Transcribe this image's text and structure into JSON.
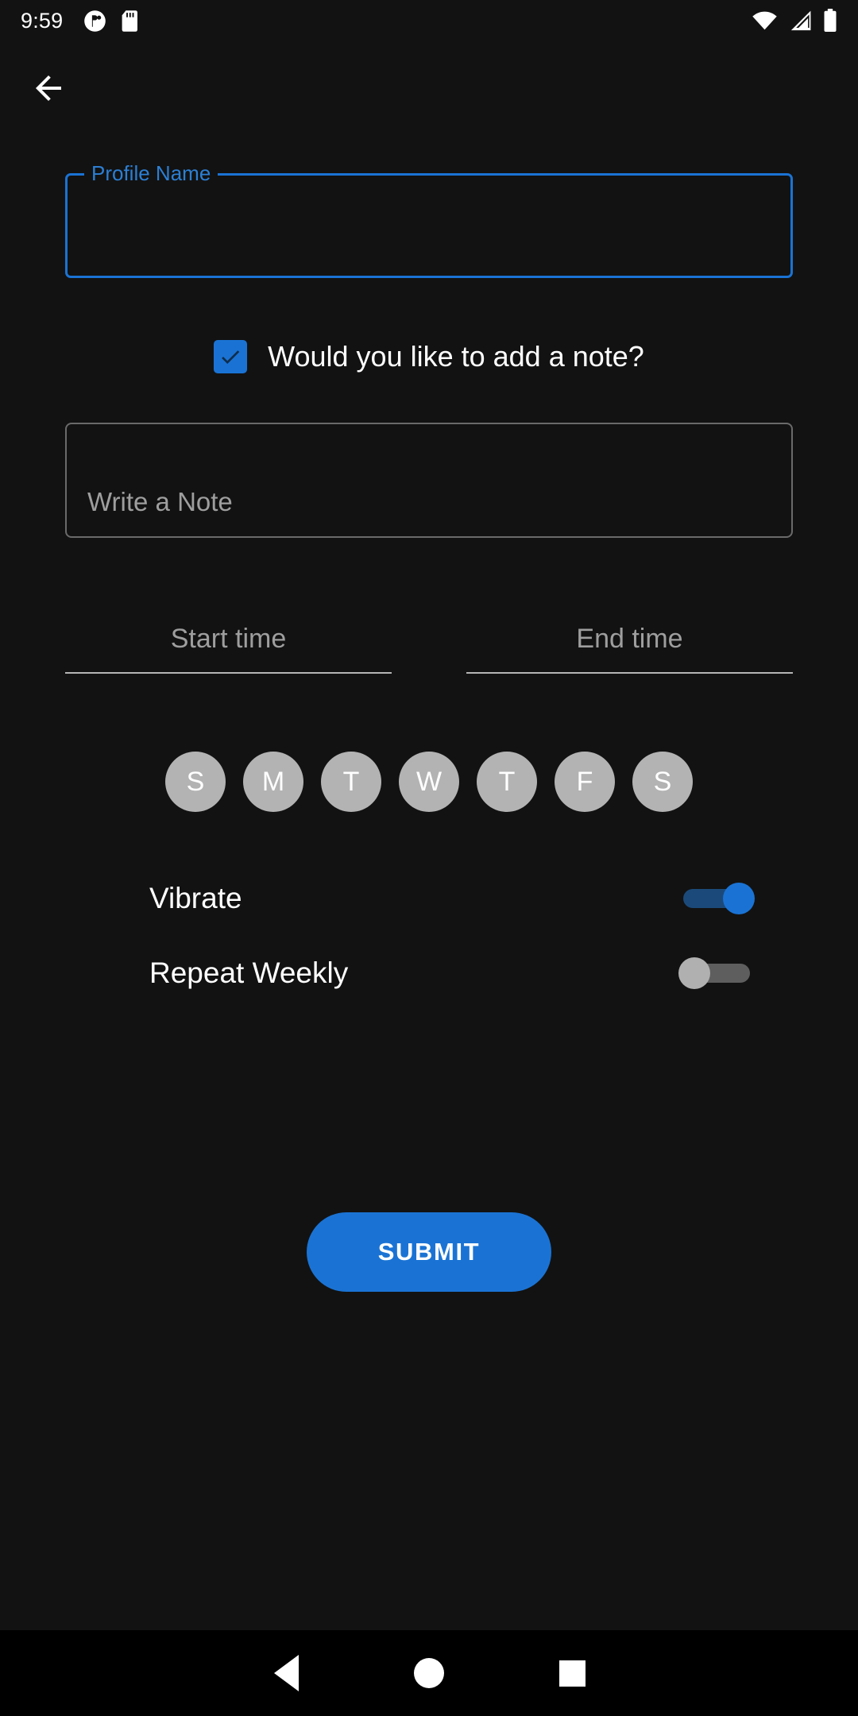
{
  "status_bar": {
    "time": "9:59",
    "left_icons": [
      "contacts-sync-icon",
      "sd-card-icon"
    ],
    "right_icons": [
      "wifi-icon",
      "cellular-signal-icon",
      "battery-full-icon"
    ]
  },
  "appbar": {
    "back_icon": "arrow-back-icon"
  },
  "form": {
    "profile": {
      "label": "Profile Name",
      "value": "",
      "placeholder": ""
    },
    "note_checkbox": {
      "label": "Would you like to add a note?",
      "checked": true
    },
    "note": {
      "value": "",
      "placeholder": "Write a Note"
    },
    "start_time": {
      "value": "",
      "placeholder": "Start time"
    },
    "end_time": {
      "value": "",
      "placeholder": "End time"
    },
    "days": [
      {
        "letter": "S",
        "name": "sunday",
        "selected": false
      },
      {
        "letter": "M",
        "name": "monday",
        "selected": false
      },
      {
        "letter": "T",
        "name": "tuesday",
        "selected": false
      },
      {
        "letter": "W",
        "name": "wednesday",
        "selected": false
      },
      {
        "letter": "T",
        "name": "thursday",
        "selected": false
      },
      {
        "letter": "F",
        "name": "friday",
        "selected": false
      },
      {
        "letter": "S",
        "name": "saturday",
        "selected": false
      }
    ],
    "vibrate": {
      "label": "Vibrate",
      "state": "on"
    },
    "repeat_weekly": {
      "label": "Repeat Weekly",
      "state": "off"
    },
    "submit_label": "SUBMIT"
  },
  "nav_bar": {
    "back": "nav-back-icon",
    "home": "nav-home-icon",
    "recents": "nav-recents-icon"
  },
  "colors": {
    "accent": "#1a73d4",
    "label_blue": "#2c7fd4",
    "background": "#121212",
    "day_circle": "#b3b3b3",
    "hint": "#9e9e9e"
  }
}
